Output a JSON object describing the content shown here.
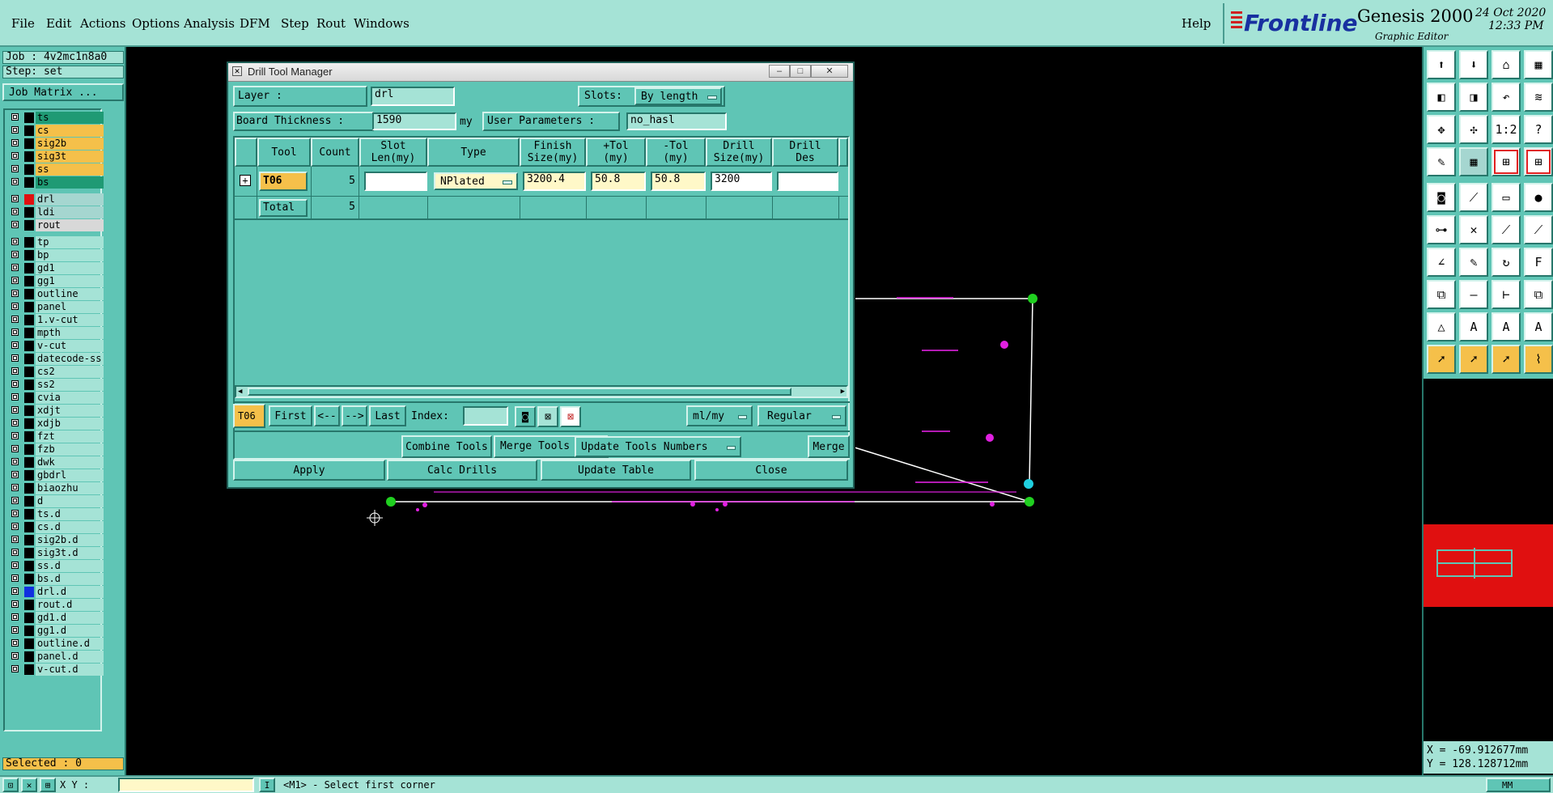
{
  "menubar": {
    "items": [
      "File",
      "Edit",
      "Actions",
      "Options",
      "Analysis",
      "DFM",
      "Step",
      "Rout",
      "Windows"
    ],
    "help": "Help",
    "brand": "Frontline",
    "product": "Genesis 2000",
    "subtitle": "Graphic Editor",
    "date": "24 Oct 2020",
    "time": "12:33 PM"
  },
  "left_panel": {
    "job": "Job : 4v2mc1n8a0",
    "step": "Step: set",
    "job_matrix": "Job Matrix ...",
    "selected": "Selected : 0",
    "layers": [
      {
        "name": "ts",
        "color": "#1f9a74"
      },
      {
        "name": "cs",
        "color": "#f5c04a"
      },
      {
        "name": "sig2b",
        "color": "#f5c04a"
      },
      {
        "name": "sig3t",
        "color": "#f5c04a"
      },
      {
        "name": "ss",
        "color": "#f5c04a"
      },
      {
        "name": "bs",
        "color": "#1f9a74"
      },
      {
        "name": "drl",
        "color": "#a5d6d0",
        "swatch": "#e01010",
        "active": true
      },
      {
        "name": "ldi",
        "color": "#a5d6d0"
      },
      {
        "name": "rout",
        "color": "#d8d8d8"
      },
      {
        "name": "tp",
        "color": "#a5e3d6"
      },
      {
        "name": "bp",
        "color": "#a5e3d6"
      },
      {
        "name": "gd1",
        "color": "#a5e3d6"
      },
      {
        "name": "gg1",
        "color": "#a5e3d6"
      },
      {
        "name": "outline",
        "color": "#a5e3d6"
      },
      {
        "name": "panel",
        "color": "#a5e3d6"
      },
      {
        "name": "1.v-cut",
        "color": "#a5e3d6"
      },
      {
        "name": "mpth",
        "color": "#a5e3d6"
      },
      {
        "name": "v-cut",
        "color": "#a5e3d6"
      },
      {
        "name": "datecode-ss",
        "color": "#a5e3d6"
      },
      {
        "name": "cs2",
        "color": "#a5e3d6"
      },
      {
        "name": "ss2",
        "color": "#a5e3d6"
      },
      {
        "name": "cvia",
        "color": "#a5e3d6"
      },
      {
        "name": "xdjt",
        "color": "#a5e3d6"
      },
      {
        "name": "xdjb",
        "color": "#a5e3d6"
      },
      {
        "name": "fzt",
        "color": "#a5e3d6"
      },
      {
        "name": "fzb",
        "color": "#a5e3d6"
      },
      {
        "name": "dwk",
        "color": "#a5e3d6"
      },
      {
        "name": "gbdrl",
        "color": "#a5e3d6"
      },
      {
        "name": "biaozhu",
        "color": "#a5e3d6"
      },
      {
        "name": "d",
        "color": "#a5e3d6"
      },
      {
        "name": "ts.d",
        "color": "#a5e3d6"
      },
      {
        "name": "cs.d",
        "color": "#a5e3d6"
      },
      {
        "name": "sig2b.d",
        "color": "#a5e3d6"
      },
      {
        "name": "sig3t.d",
        "color": "#a5e3d6"
      },
      {
        "name": "ss.d",
        "color": "#a5e3d6"
      },
      {
        "name": "bs.d",
        "color": "#a5e3d6"
      },
      {
        "name": "drl.d",
        "color": "#a5e3d6",
        "swatch": "#1030e0"
      },
      {
        "name": "rout.d",
        "color": "#a5e3d6"
      },
      {
        "name": "gd1.d",
        "color": "#a5e3d6"
      },
      {
        "name": "gg1.d",
        "color": "#a5e3d6"
      },
      {
        "name": "outline.d",
        "color": "#a5e3d6"
      },
      {
        "name": "panel.d",
        "color": "#a5e3d6"
      },
      {
        "name": "v-cut.d",
        "color": "#a5e3d6"
      }
    ]
  },
  "dialog": {
    "title": "Drill Tool Manager",
    "layer_label": "Layer          :",
    "layer_value": "drl",
    "slots_label": "Slots:",
    "slots_value": "By length",
    "board_thickness_label": "Board Thickness :",
    "board_thickness_value": "1590",
    "board_thickness_unit": "my",
    "user_params_label": "User Parameters :",
    "user_params_value": "no_hasl",
    "headers": [
      "Tool",
      "Count",
      "Slot\nLen(my)",
      "Type",
      "Finish\nSize(my)",
      "+Tol\n(my)",
      "-Tol\n(my)",
      "Drill\nSize(my)",
      "Drill\nDes"
    ],
    "row": {
      "tool": "T06",
      "count": "5",
      "slot_len": "",
      "type": "NPlated",
      "finish": "3200.4",
      "plus_tol": "50.8",
      "minus_tol": "50.8",
      "drill_size": "3200",
      "drill_des": ""
    },
    "total": {
      "label": "Total",
      "count": "5"
    },
    "nav": {
      "current": "T06",
      "first": "First",
      "prev": "<--",
      "next": "-->",
      "last": "Last",
      "index_label": "Index:",
      "index_value": "",
      "units": "ml/my",
      "mode": "Regular"
    },
    "combine_tools": "Combine Tools",
    "merge_tools_label": "Merge Tools :",
    "merge_tools_value": "Update Tools Numbers",
    "merge": "Merge",
    "apply": "Apply",
    "calc_drills": "Calc Drills",
    "update_table": "Update Table",
    "close": "Close"
  },
  "coords": {
    "x": "X = -69.912677mm",
    "y": "Y = 128.128712mm"
  },
  "status": {
    "xy_label": "X Y :",
    "message": "<M1> - Select first corner",
    "units": "MM"
  }
}
